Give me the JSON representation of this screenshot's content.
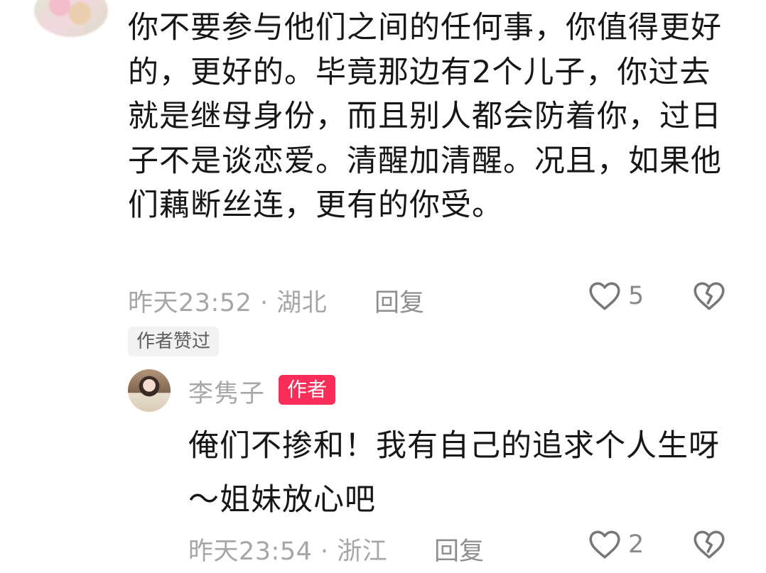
{
  "comment": {
    "text": "你不要参与他们之间的任何事，你值得更好的，更好的。毕竟那边有2个儿子，你过去就是继母身份，而且别人都会防着你，过日子不是谈恋爱。清醒加清醒。况且，如果他们藕断丝连，更有的你受。",
    "meta": "昨天23:52 · 湖北",
    "reply_label": "回复",
    "like_count": "5",
    "author_liked_label": "作者赞过"
  },
  "reply": {
    "name": "李隽子",
    "badge": "作者",
    "text": "俺们不掺和！我有自己的追求个人生呀～姐妹放心吧",
    "meta": "昨天23:54 · 浙江",
    "reply_label": "回复",
    "like_count": "2"
  },
  "icons": {
    "like": "heart-outline-icon",
    "dislike": "broken-heart-icon"
  }
}
